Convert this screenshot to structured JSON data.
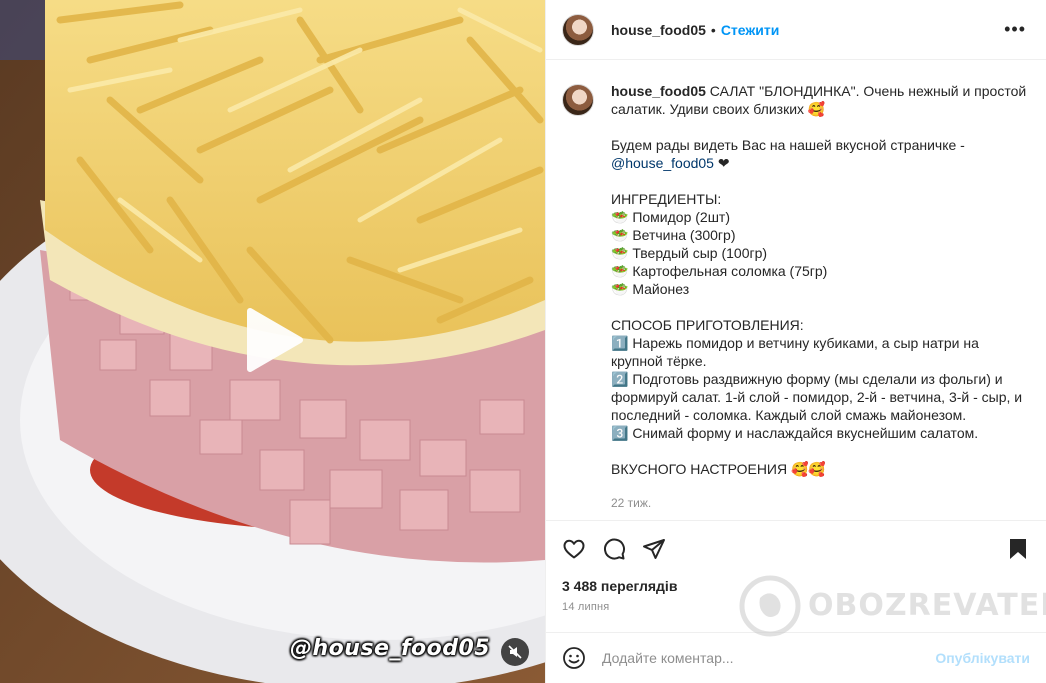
{
  "media": {
    "video_handle": "@house_food05"
  },
  "header": {
    "username": "house_food05",
    "separator": "•",
    "follow_label": "Стежити",
    "more_label": "•••"
  },
  "caption": {
    "username": "house_food05",
    "lines": [
      "САЛАТ \"БЛОНДИНКА\". Очень нежный и простой салатик. Удиви своих близких 🥰",
      "",
      "Будем рады видеть Вас на нашей вкусной страничке -",
      "",
      "ИНГРЕДИЕНТЫ:",
      "🥗 Помидор (2шт)",
      "🥗 Ветчина (300гр)",
      "🥗 Твердый сыр (100гр)",
      "🥗 Картофельная соломка (75гр)",
      "🥗 Майонез",
      "",
      "СПОСОБ ПРИГОТОВЛЕНИЯ:",
      "1️⃣ Нарежь помидор и ветчину кубиками, а сыр натри на крупной тёрке.",
      "2️⃣ Подготовь раздвижную форму (мы сделали из фольги) и формируй салат. 1-й слой - помидор, 2-й - ветчина, 3-й - сыр, и последний - соломка. Каждый слой смажь майонезом.",
      "3️⃣ Снимай форму и наслаждайся вкуснейшим салатом.",
      "",
      "ВКУСНОГО НАСТРОЕНИЯ 🥰🥰"
    ],
    "mention": "@house_food05",
    "mention_suffix": " ❤",
    "time": "22 тиж."
  },
  "actions": {
    "like_icon": "heart-icon",
    "comment_icon": "comment-icon",
    "share_icon": "share-icon",
    "save_icon": "bookmark-icon"
  },
  "stats": {
    "views": "3 488 переглядів",
    "date": "14 липня"
  },
  "comment": {
    "placeholder": "Додайте коментар...",
    "publish_label": "Опублікувати"
  },
  "watermark": {
    "text": "OBOZREVATEL"
  },
  "colors": {
    "accent": "#0095f6",
    "publish_disabled": "#b2dffc",
    "mention": "#00376b",
    "muted": "#8e8e8e"
  }
}
